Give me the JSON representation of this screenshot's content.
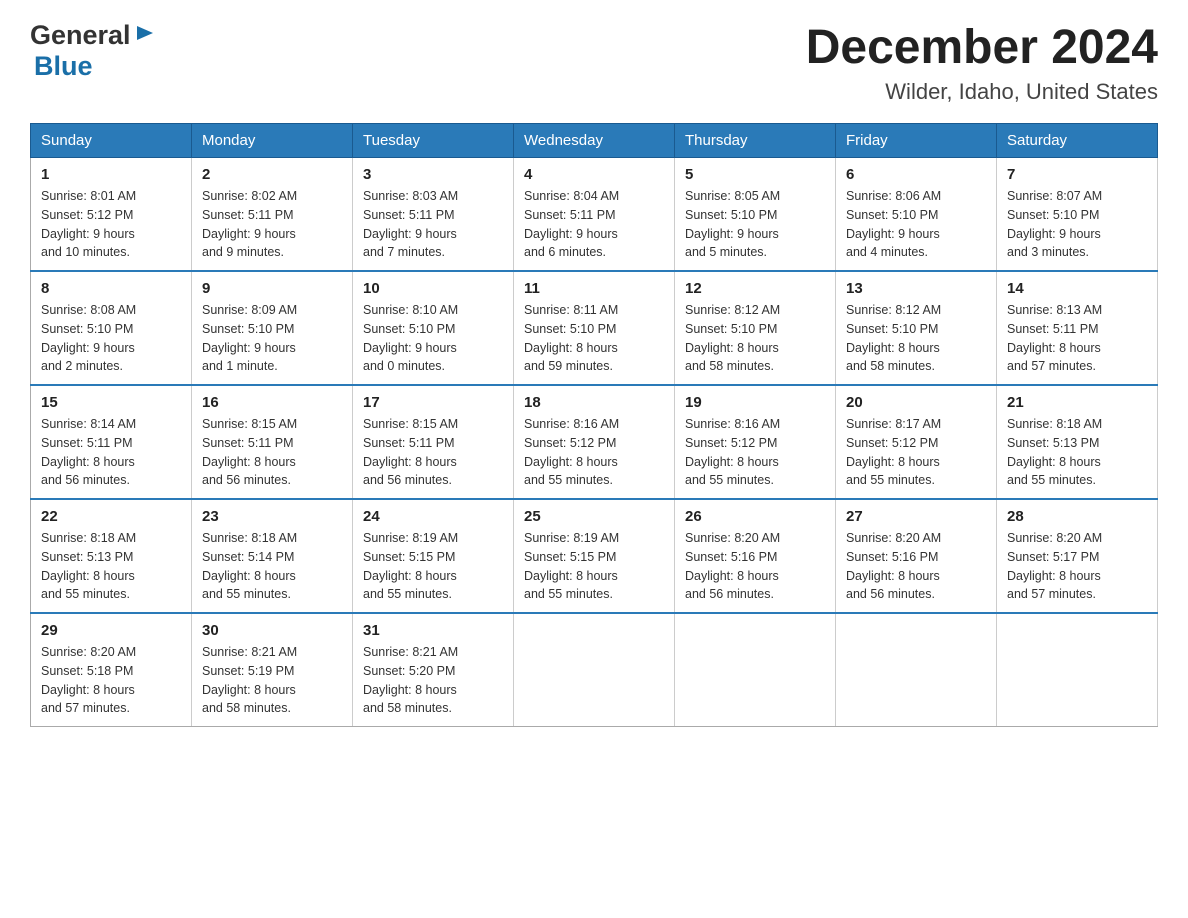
{
  "header": {
    "logo_general": "General",
    "logo_blue": "Blue",
    "month_title": "December 2024",
    "location": "Wilder, Idaho, United States"
  },
  "days_of_week": [
    "Sunday",
    "Monday",
    "Tuesday",
    "Wednesday",
    "Thursday",
    "Friday",
    "Saturday"
  ],
  "weeks": [
    [
      {
        "day": "1",
        "sunrise": "8:01 AM",
        "sunset": "5:12 PM",
        "daylight": "9 hours and 10 minutes."
      },
      {
        "day": "2",
        "sunrise": "8:02 AM",
        "sunset": "5:11 PM",
        "daylight": "9 hours and 9 minutes."
      },
      {
        "day": "3",
        "sunrise": "8:03 AM",
        "sunset": "5:11 PM",
        "daylight": "9 hours and 7 minutes."
      },
      {
        "day": "4",
        "sunrise": "8:04 AM",
        "sunset": "5:11 PM",
        "daylight": "9 hours and 6 minutes."
      },
      {
        "day": "5",
        "sunrise": "8:05 AM",
        "sunset": "5:10 PM",
        "daylight": "9 hours and 5 minutes."
      },
      {
        "day": "6",
        "sunrise": "8:06 AM",
        "sunset": "5:10 PM",
        "daylight": "9 hours and 4 minutes."
      },
      {
        "day": "7",
        "sunrise": "8:07 AM",
        "sunset": "5:10 PM",
        "daylight": "9 hours and 3 minutes."
      }
    ],
    [
      {
        "day": "8",
        "sunrise": "8:08 AM",
        "sunset": "5:10 PM",
        "daylight": "9 hours and 2 minutes."
      },
      {
        "day": "9",
        "sunrise": "8:09 AM",
        "sunset": "5:10 PM",
        "daylight": "9 hours and 1 minute."
      },
      {
        "day": "10",
        "sunrise": "8:10 AM",
        "sunset": "5:10 PM",
        "daylight": "9 hours and 0 minutes."
      },
      {
        "day": "11",
        "sunrise": "8:11 AM",
        "sunset": "5:10 PM",
        "daylight": "8 hours and 59 minutes."
      },
      {
        "day": "12",
        "sunrise": "8:12 AM",
        "sunset": "5:10 PM",
        "daylight": "8 hours and 58 minutes."
      },
      {
        "day": "13",
        "sunrise": "8:12 AM",
        "sunset": "5:10 PM",
        "daylight": "8 hours and 58 minutes."
      },
      {
        "day": "14",
        "sunrise": "8:13 AM",
        "sunset": "5:11 PM",
        "daylight": "8 hours and 57 minutes."
      }
    ],
    [
      {
        "day": "15",
        "sunrise": "8:14 AM",
        "sunset": "5:11 PM",
        "daylight": "8 hours and 56 minutes."
      },
      {
        "day": "16",
        "sunrise": "8:15 AM",
        "sunset": "5:11 PM",
        "daylight": "8 hours and 56 minutes."
      },
      {
        "day": "17",
        "sunrise": "8:15 AM",
        "sunset": "5:11 PM",
        "daylight": "8 hours and 56 minutes."
      },
      {
        "day": "18",
        "sunrise": "8:16 AM",
        "sunset": "5:12 PM",
        "daylight": "8 hours and 55 minutes."
      },
      {
        "day": "19",
        "sunrise": "8:16 AM",
        "sunset": "5:12 PM",
        "daylight": "8 hours and 55 minutes."
      },
      {
        "day": "20",
        "sunrise": "8:17 AM",
        "sunset": "5:12 PM",
        "daylight": "8 hours and 55 minutes."
      },
      {
        "day": "21",
        "sunrise": "8:18 AM",
        "sunset": "5:13 PM",
        "daylight": "8 hours and 55 minutes."
      }
    ],
    [
      {
        "day": "22",
        "sunrise": "8:18 AM",
        "sunset": "5:13 PM",
        "daylight": "8 hours and 55 minutes."
      },
      {
        "day": "23",
        "sunrise": "8:18 AM",
        "sunset": "5:14 PM",
        "daylight": "8 hours and 55 minutes."
      },
      {
        "day": "24",
        "sunrise": "8:19 AM",
        "sunset": "5:15 PM",
        "daylight": "8 hours and 55 minutes."
      },
      {
        "day": "25",
        "sunrise": "8:19 AM",
        "sunset": "5:15 PM",
        "daylight": "8 hours and 55 minutes."
      },
      {
        "day": "26",
        "sunrise": "8:20 AM",
        "sunset": "5:16 PM",
        "daylight": "8 hours and 56 minutes."
      },
      {
        "day": "27",
        "sunrise": "8:20 AM",
        "sunset": "5:16 PM",
        "daylight": "8 hours and 56 minutes."
      },
      {
        "day": "28",
        "sunrise": "8:20 AM",
        "sunset": "5:17 PM",
        "daylight": "8 hours and 57 minutes."
      }
    ],
    [
      {
        "day": "29",
        "sunrise": "8:20 AM",
        "sunset": "5:18 PM",
        "daylight": "8 hours and 57 minutes."
      },
      {
        "day": "30",
        "sunrise": "8:21 AM",
        "sunset": "5:19 PM",
        "daylight": "8 hours and 58 minutes."
      },
      {
        "day": "31",
        "sunrise": "8:21 AM",
        "sunset": "5:20 PM",
        "daylight": "8 hours and 58 minutes."
      },
      null,
      null,
      null,
      null
    ]
  ],
  "labels": {
    "sunrise_prefix": "Sunrise: ",
    "sunset_prefix": "Sunset: ",
    "daylight_prefix": "Daylight: "
  }
}
